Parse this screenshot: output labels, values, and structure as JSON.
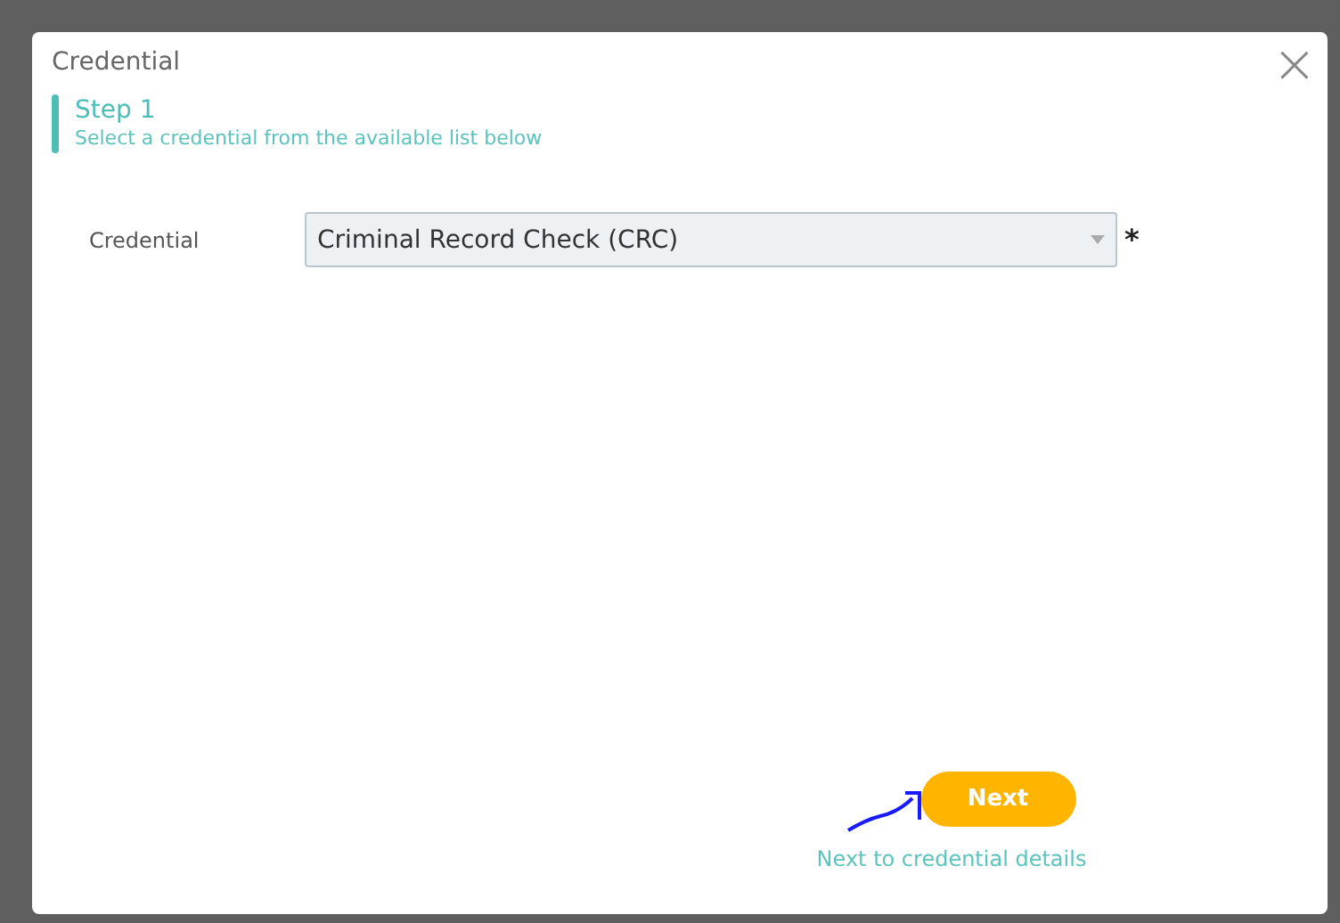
{
  "dialog": {
    "title": "Credential",
    "close": "×"
  },
  "step": {
    "title": "Step 1",
    "subtitle": "Select a credential from the available list below"
  },
  "field": {
    "label": "Credential",
    "value": "Criminal Record Check (CRC)",
    "required": true,
    "required_mark": "*"
  },
  "footer": {
    "button": "Next",
    "hint": "Next to credential details"
  }
}
